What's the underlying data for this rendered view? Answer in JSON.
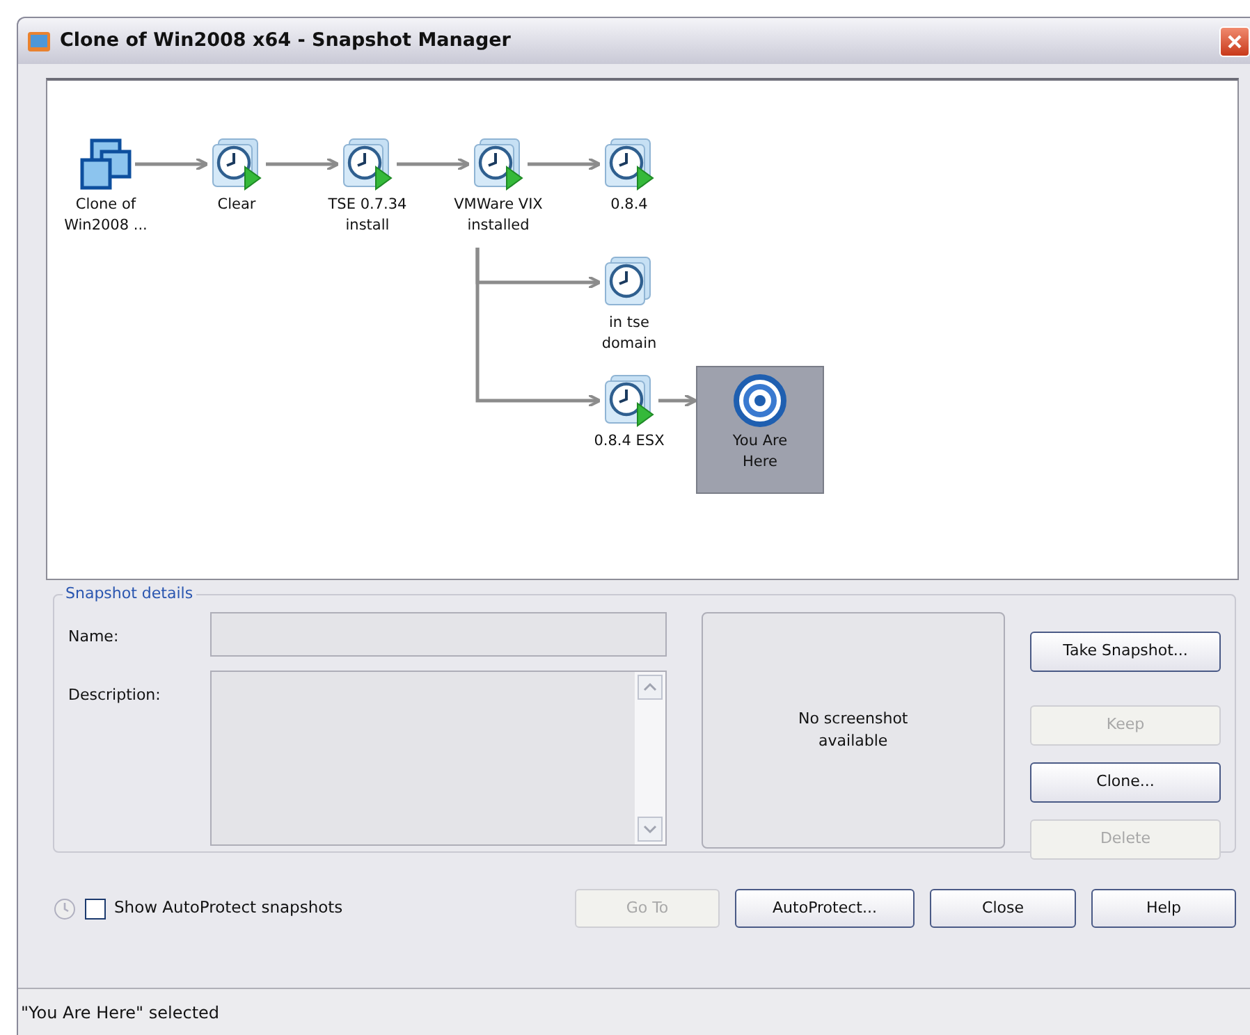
{
  "window": {
    "title": "Clone of Win2008 x64 - Snapshot Manager"
  },
  "snapshot_tree": {
    "label": "Clone of\nWin2008 ...",
    "kind": "vm",
    "selected": false,
    "children": [
      {
        "label": "Clear",
        "kind": "snapshot",
        "powered_on": true,
        "selected": false,
        "children": [
          {
            "label": "TSE 0.7.34\ninstall",
            "kind": "snapshot",
            "powered_on": true,
            "selected": false,
            "children": [
              {
                "label": "VMWare VIX\ninstalled",
                "kind": "snapshot",
                "powered_on": true,
                "selected": false,
                "children": [
                  {
                    "label": "0.8.4",
                    "kind": "snapshot",
                    "powered_on": true,
                    "selected": false
                  },
                  {
                    "label": "in tse\ndomain",
                    "kind": "snapshot",
                    "powered_on": false,
                    "selected": false
                  },
                  {
                    "label": "0.8.4 ESX",
                    "kind": "snapshot",
                    "powered_on": true,
                    "selected": false,
                    "children": [
                      {
                        "label": "You Are\nHere",
                        "kind": "current",
                        "selected": true
                      }
                    ]
                  }
                ]
              }
            ]
          }
        ]
      }
    ]
  },
  "details": {
    "legend": "Snapshot details",
    "name_label": "Name:",
    "description_label": "Description:",
    "preview_text": "No screenshot\navailable",
    "buttons": [
      {
        "label": "Take Snapshot...",
        "disabled": false
      },
      {
        "label": "Keep",
        "disabled": true
      },
      {
        "label": "Clone...",
        "disabled": false
      },
      {
        "label": "Delete",
        "disabled": true
      }
    ]
  },
  "show_autoprotect": {
    "label": "Show AutoProtect snapshots",
    "checked": false
  },
  "footer_buttons": [
    {
      "label": "Go To",
      "disabled": true
    },
    {
      "label": "AutoProtect...",
      "disabled": false
    },
    {
      "label": "Close",
      "disabled": false
    },
    {
      "label": "Help",
      "disabled": false
    }
  ],
  "status_bar": "\"You Are Here\" selected"
}
